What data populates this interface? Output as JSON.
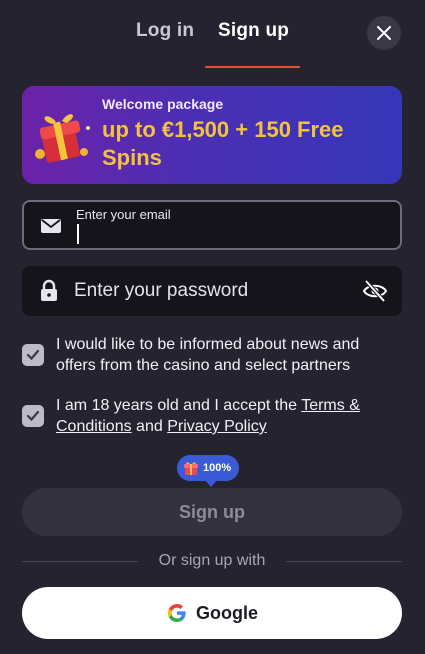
{
  "tabs": {
    "login_label": "Log in",
    "signup_label": "Sign up",
    "active": "signup"
  },
  "banner": {
    "package_label": "Welcome package",
    "offer_text": "up to €1,500 + 150 Free Spins",
    "gift_icon": "gift-box-icon"
  },
  "email": {
    "label": "Enter your email",
    "value": "",
    "icon": "envelope-icon"
  },
  "password": {
    "placeholder": "Enter your password",
    "value": "",
    "icon": "lock-icon",
    "toggle_icon": "eye-slash-icon"
  },
  "consents": {
    "news": {
      "checked": true,
      "text": "I would like to be informed about news and offers from the casino and select partners"
    },
    "age": {
      "checked": true,
      "text_prefix": "I am 18 years old and I accept the ",
      "terms_link": "Terms & Conditions",
      "text_middle": " and ",
      "privacy_link": "Privacy Policy"
    }
  },
  "progress_badge": {
    "value": "100%",
    "progress": 1.0,
    "icon": "gift-icon"
  },
  "signup_button": {
    "label": "Sign up"
  },
  "divider": {
    "text": "Or sign up with"
  },
  "google_button": {
    "label": "Google",
    "icon": "google-icon"
  },
  "colors": {
    "background": "#25232f",
    "accent": "#e2542f",
    "offer_text": "#f5c23e",
    "badge": "#3b5bd6"
  }
}
